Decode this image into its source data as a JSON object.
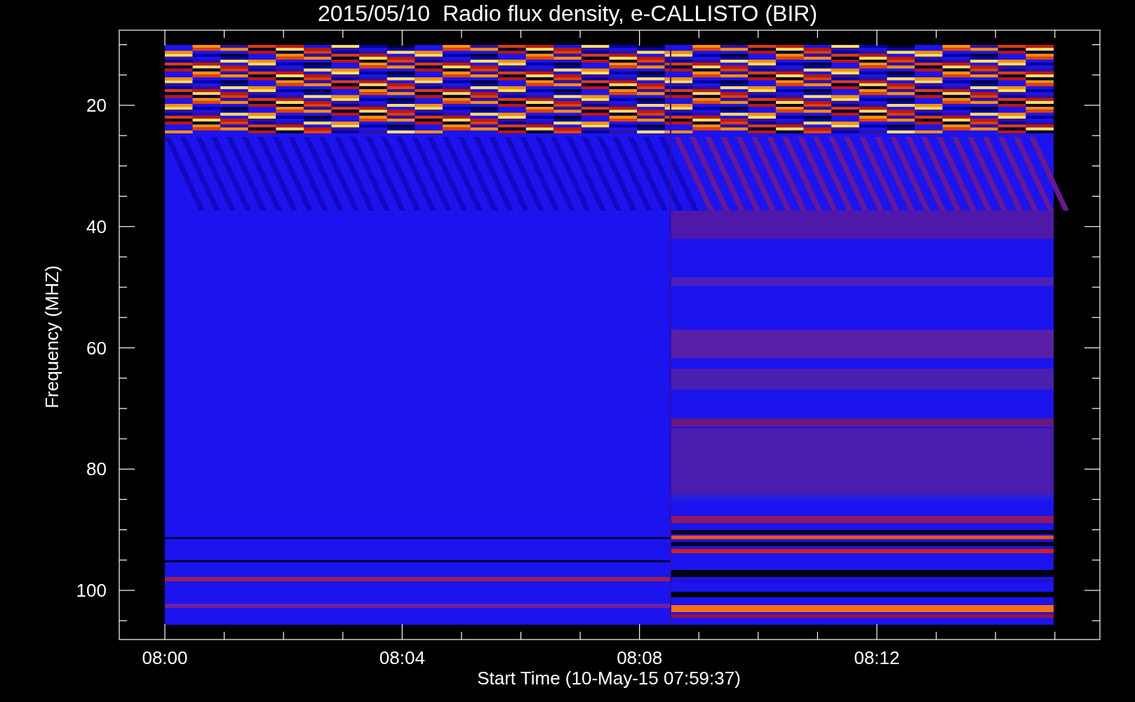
{
  "title": "2015/05/10  Radio flux density, e-CALLISTO (BIR)",
  "ylabel": "Frequency (MHZ)",
  "xlabel": "Start Time (10-May-15 07:59:37)",
  "yticks": [
    "20",
    "40",
    "60",
    "80",
    "100"
  ],
  "xticks": [
    "08:00",
    "08:04",
    "08:08",
    "08:12"
  ]
}
